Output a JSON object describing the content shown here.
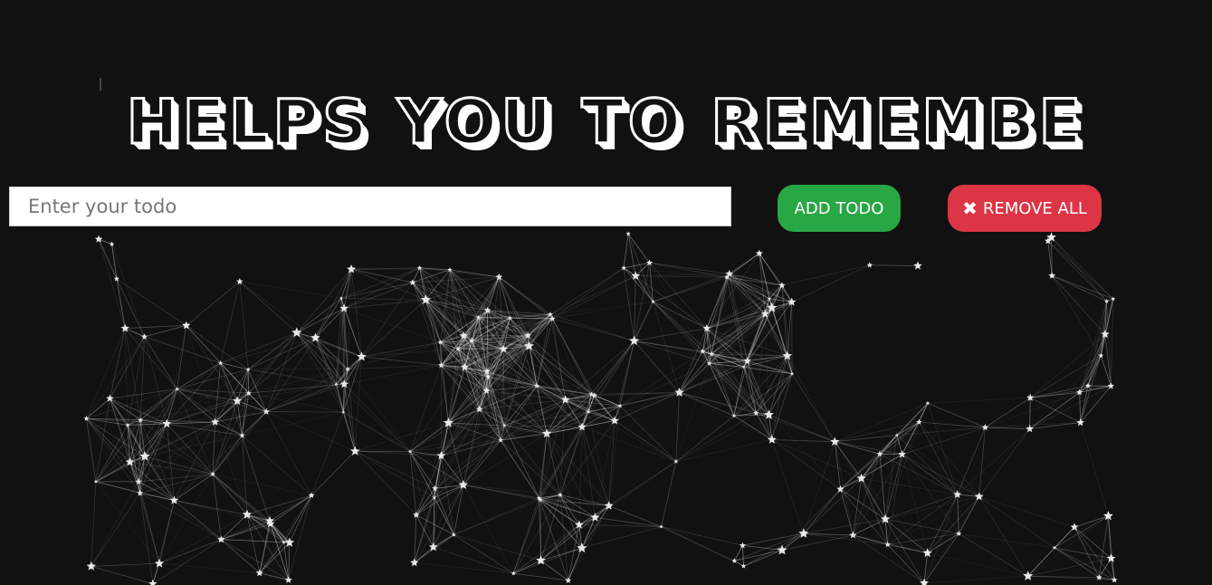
{
  "header": {
    "title": "HELPS YOU TO REMEMBE"
  },
  "todo_form": {
    "input_value": "",
    "input_placeholder": "Enter your todo",
    "add_label": "ADD TODO",
    "remove_label": "REMOVE ALL",
    "remove_icon": "close-icon"
  },
  "colors": {
    "background": "#111111",
    "add_button": "#28a745",
    "remove_button": "#dc3545",
    "network_lines": "#ffffff"
  }
}
